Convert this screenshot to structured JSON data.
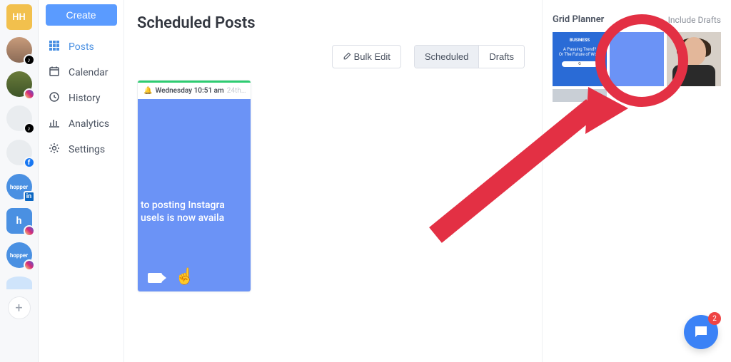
{
  "workspace": {
    "initials": "HH",
    "accounts": [
      {
        "platform": "tiktok"
      },
      {
        "platform": "instagram"
      },
      {
        "platform": "tiktok"
      },
      {
        "platform": "facebook"
      },
      {
        "platform": "linkedin",
        "hopper": true
      },
      {
        "platform": "instagram",
        "hopper_sq": true
      },
      {
        "platform": "instagram",
        "hopper": true
      }
    ]
  },
  "nav": {
    "create": "Create",
    "items": [
      {
        "label": "Posts",
        "active": true
      },
      {
        "label": "Calendar"
      },
      {
        "label": "History"
      },
      {
        "label": "Analytics"
      },
      {
        "label": "Settings"
      }
    ]
  },
  "main": {
    "title": "Scheduled Posts",
    "bulk_edit": "Bulk Edit",
    "tab_scheduled": "Scheduled",
    "tab_drafts": "Drafts"
  },
  "post": {
    "day": "Wednesday",
    "time": "10:51 am",
    "date_trunc": "24th…",
    "caption_line1": "to posting Instagra",
    "caption_line2": "usels is now availa"
  },
  "grid_planner": {
    "title": "Grid Planner",
    "include_drafts": "Include Drafts",
    "tile1_line1": "BUSINESS",
    "tile1_line2": "A Passing Trend?",
    "tile1_line3": "Or The Future of Work"
  },
  "chat": {
    "badge": "2"
  }
}
